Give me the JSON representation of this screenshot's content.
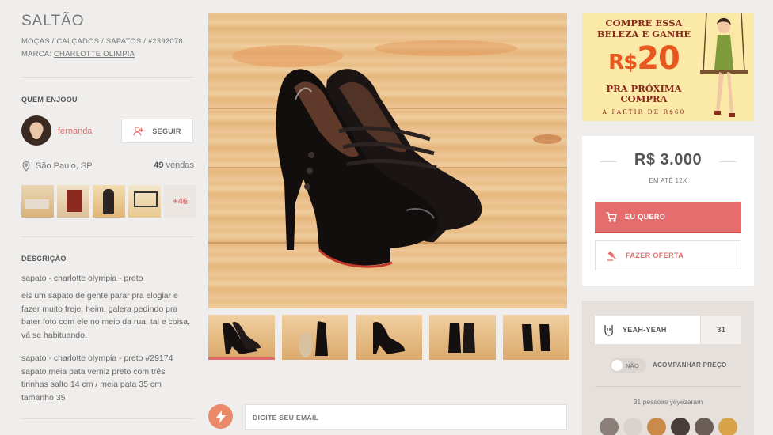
{
  "product": {
    "title": "SALTÃO",
    "breadcrumb": "MOÇAS / CALÇADOS / SAPATOS / #2392078",
    "brand_label": "MARCA:",
    "brand": "CHARLOTTE OLIMPIA"
  },
  "seller": {
    "section_title": "QUEM ENJOOU",
    "name": "fernanda",
    "follow_label": "SEGUIR",
    "location": "São Paulo, SP",
    "sales_count": "49",
    "sales_label": "vendas",
    "more_items": "+46"
  },
  "description": {
    "section_title": "DESCRIÇÃO",
    "subtitle": "sapato - charlotte olympia - preto",
    "body": "eis um sapato de gente parar pra elogiar e fazer muito freje, heim. galera pedindo pra bater foto com ele no meio da rua, tal e coisa, vá se habituando.",
    "details": "sapato - charlotte olympia - preto #29174 sapato meia pata verniz preto com três tirinhas salto 14 cm / meia pata 35 cm tamanho 35"
  },
  "promo": {
    "line1": "COMPRE ESSA BELEZA E GANHE",
    "amount_prefix": "R$",
    "amount": "20",
    "line2": "PRA PRÓXIMA COMPRA",
    "line3": "A PARTIR DE R$60"
  },
  "purchase": {
    "price": "R$ 3.000",
    "installments": "EM ATÉ 12X",
    "buy_label": "EU QUERO",
    "offer_label": "FAZER OFERTA"
  },
  "social": {
    "yeah_label": "YEAH-YEAH",
    "yeah_count": "31",
    "toggle_state": "NÃO",
    "track_label": "ACOMPANHAR PREÇO",
    "yeyeh_text": "31 pessoas yeyezaram"
  },
  "newsletter": {
    "placeholder": "DIGITE SEU EMAIL"
  },
  "colors": {
    "accent": "#e56d6d",
    "background": "#f0eeec",
    "promo_bg": "#fbe9a8"
  }
}
